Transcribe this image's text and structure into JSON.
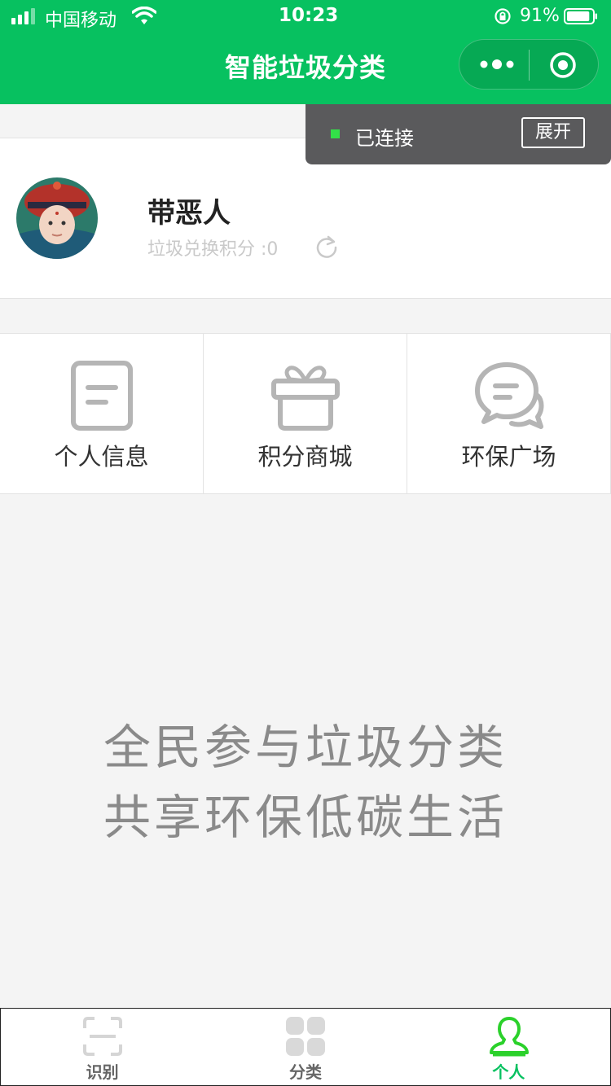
{
  "status_bar": {
    "carrier": "中国移动",
    "time": "10:23",
    "battery": "91%",
    "battery_level": 0.91
  },
  "nav": {
    "title": "智能垃圾分类",
    "more_icon": "more-dots-icon",
    "close_icon": "target-circle-icon"
  },
  "connection": {
    "status": "已连接",
    "expand_label": "展开",
    "dot_color": "#33e048"
  },
  "profile": {
    "name": "带恶人",
    "points_text": "垃圾兑换积分 :0",
    "refresh_icon": "refresh-icon"
  },
  "menu": [
    {
      "label": "个人信息",
      "icon": "document-icon"
    },
    {
      "label": "积分商城",
      "icon": "gift-icon"
    },
    {
      "label": "环保广场",
      "icon": "chat-bubbles-icon"
    }
  ],
  "slogan": {
    "line1": "全民参与垃圾分类",
    "line2": "共享环保低碳生活"
  },
  "tabbar": [
    {
      "label": "识别",
      "icon": "scan-icon",
      "active": false
    },
    {
      "label": "分类",
      "icon": "grid-icon",
      "active": false
    },
    {
      "label": "个人",
      "icon": "person-icon",
      "active": true
    }
  ],
  "colors": {
    "brand": "#07c160",
    "background": "#f4f4f4",
    "toast": "#5a5a5c"
  }
}
